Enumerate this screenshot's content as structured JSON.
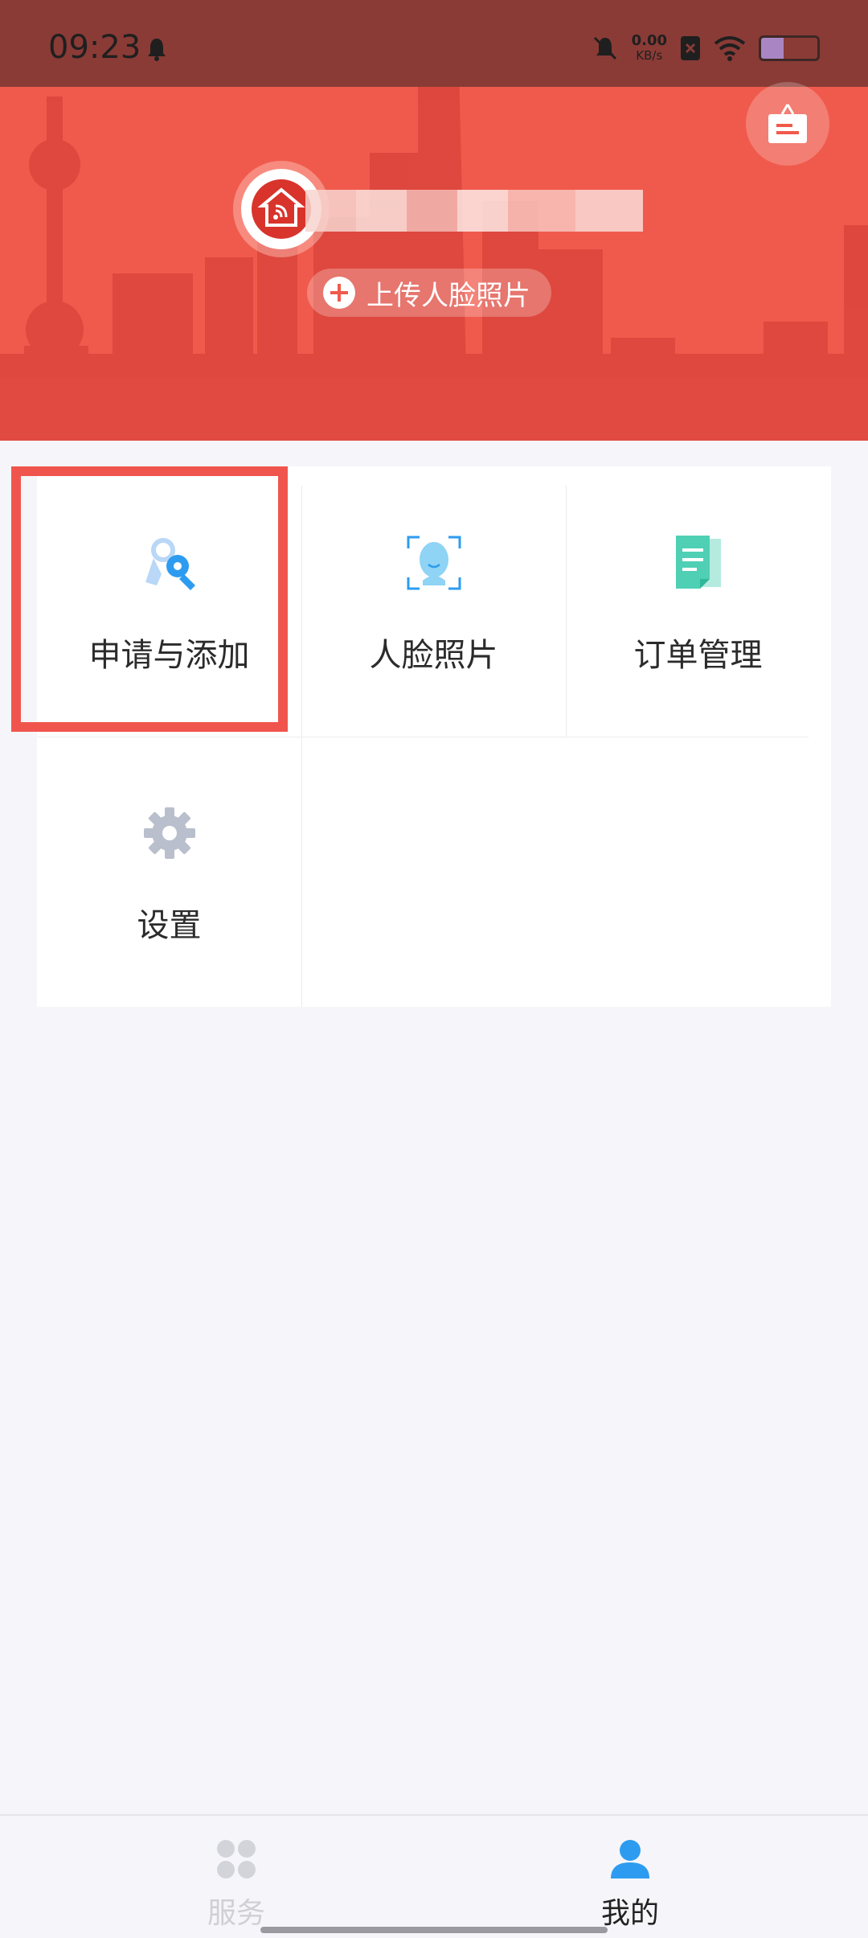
{
  "status_bar": {
    "time": "09:23",
    "net_speed_value": "0.00",
    "net_speed_unit": "KB/s"
  },
  "header": {
    "upload_face_label": "上传人脸照片"
  },
  "menu": {
    "items": [
      {
        "label": "申请与添加",
        "icon": "keys-icon"
      },
      {
        "label": "人脸照片",
        "icon": "face-scan-icon"
      },
      {
        "label": "订单管理",
        "icon": "document-icon"
      },
      {
        "label": "设置",
        "icon": "gear-icon"
      }
    ]
  },
  "bottom_nav": {
    "items": [
      {
        "label": "服务",
        "active": false
      },
      {
        "label": "我的",
        "active": true
      }
    ]
  },
  "colors": {
    "header": "#f05a4c",
    "accent_blue": "#2d9cf0",
    "highlight": "#f0554d"
  }
}
